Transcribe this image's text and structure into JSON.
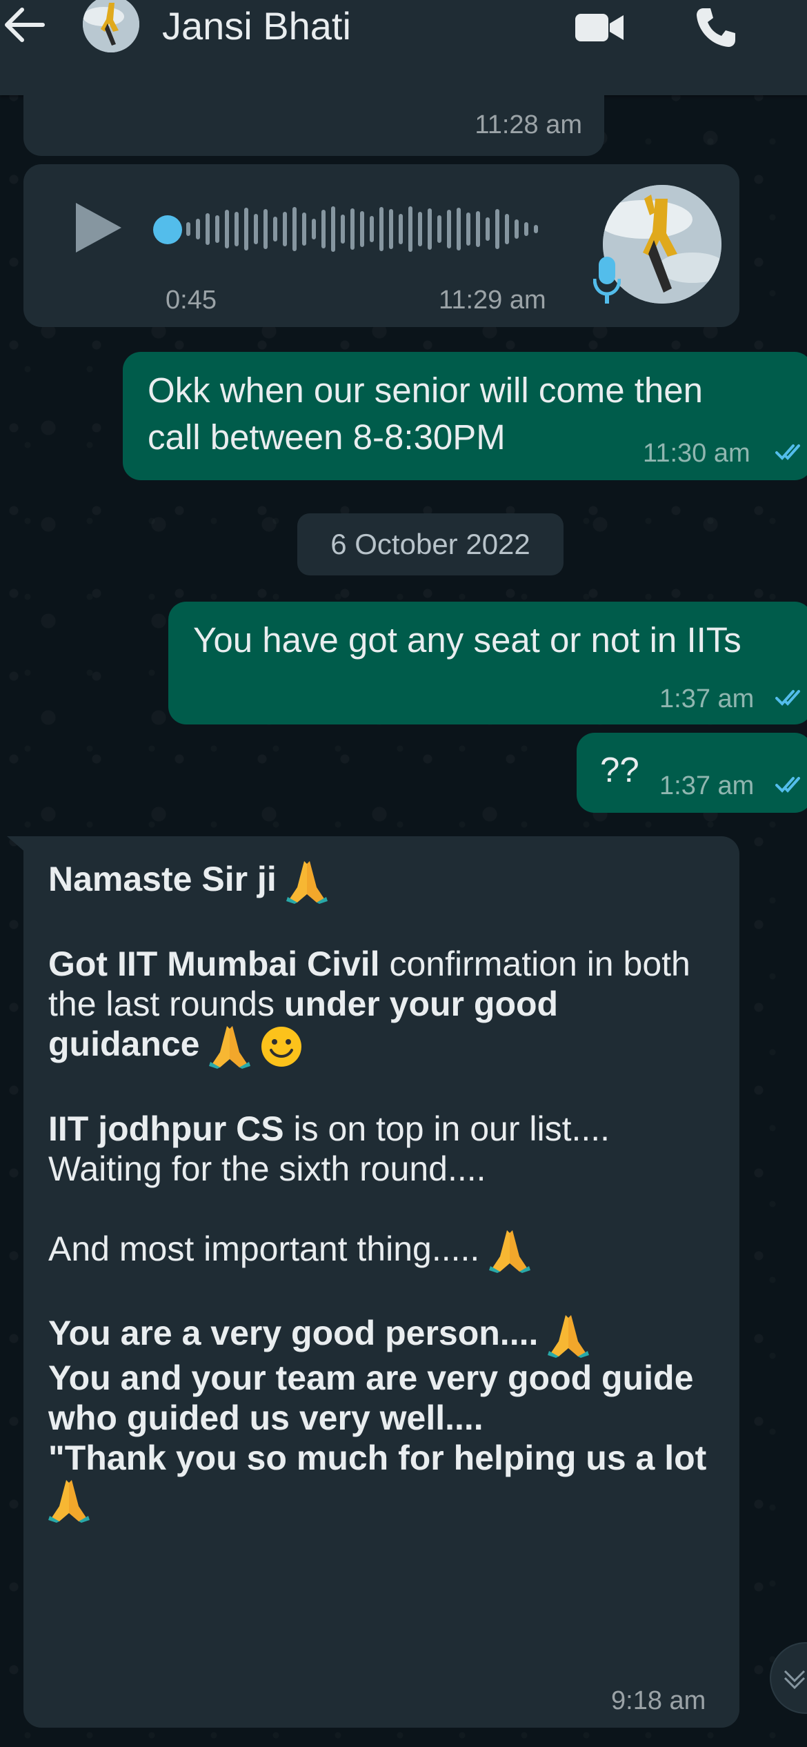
{
  "header": {
    "contact_name": "Jansi Bhati",
    "back_icon": "arrow-left-icon",
    "video_icon": "video-camera-icon",
    "call_icon": "phone-icon"
  },
  "messages": {
    "prev_time": "11:28 am",
    "voice": {
      "duration": "0:45",
      "time": "11:29 am",
      "played_fraction": 0.0
    },
    "out1": {
      "line1": "Okk when our senior will come then",
      "line2": "call between 8-8:30PM",
      "time": "11:30 am"
    },
    "date_chip": "6 October 2022",
    "out2": {
      "text": "You have got any seat or not in IITs",
      "time": "1:37 am"
    },
    "out3": {
      "text": "??",
      "time": "1:37 am"
    },
    "long": {
      "greeting": "Namaste Sir ji",
      "p2_bold1": "Got IIT Mumbai Civil",
      "p2_plain": " confirmation in both the last rounds ",
      "p2_bold2": "under your good guidance",
      "p3_bold": "IIT jodhpur CS",
      "p3_plain": " is on top in our list....",
      "p3_line2": "Waiting for the sixth round....",
      "p4": "And most important thing.....",
      "p5_line1": "You are a very good person....",
      "p5_line2": "You and your team are very good guide  who guided us very well....",
      "p5_line3": "\"Thank you so much for helping us a lot",
      "time": "9:18 am"
    }
  },
  "colors": {
    "incoming": "#1f2c34",
    "outgoing": "#005c4b",
    "read_tick": "#53bdeb"
  }
}
